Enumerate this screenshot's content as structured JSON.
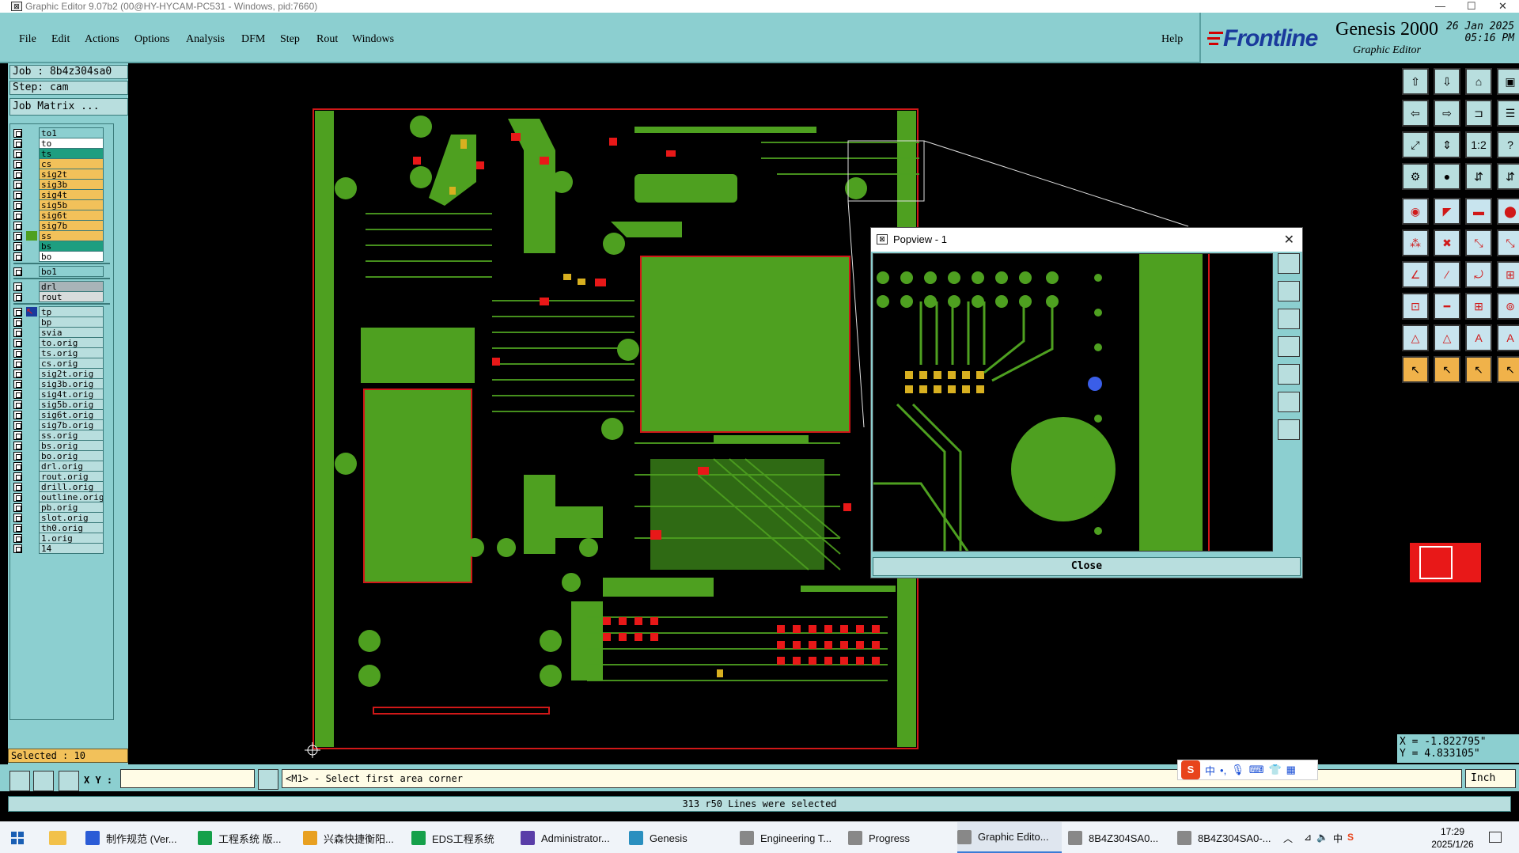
{
  "window": {
    "title": "Graphic Editor 9.07b2 (00@HY-HYCAM-PC531 - Windows, pid:7660)",
    "min": "—",
    "max": "☐",
    "close": "✕"
  },
  "menu": {
    "items": [
      "File",
      "Edit",
      "Actions",
      "Options",
      "Analysis",
      "DFM",
      "Step",
      "Rout",
      "Windows"
    ],
    "help": "Help"
  },
  "brand": {
    "logo": "Frontline",
    "product": "Genesis 2000",
    "subtitle": "Graphic Editor",
    "date": "26 Jan 2025",
    "time": "05:16 PM"
  },
  "left": {
    "job": "Job : 8b4z304sa0",
    "step": "Step: cam",
    "job_matrix": "Job Matrix ...",
    "layers_group1": [
      {
        "name": "to1",
        "color": "#8ccfd0"
      },
      {
        "name": "to",
        "color": "#ffffff"
      },
      {
        "name": "ts",
        "color": "#1e9e80"
      },
      {
        "name": "cs",
        "color": "#f2c15a"
      },
      {
        "name": "sig2t",
        "color": "#f2c15a"
      },
      {
        "name": "sig3b",
        "color": "#f2c15a"
      },
      {
        "name": "sig4t",
        "color": "#f2c15a"
      },
      {
        "name": "sig5b",
        "color": "#f2c15a"
      },
      {
        "name": "sig6t",
        "color": "#f2c15a"
      },
      {
        "name": "sig7b",
        "color": "#f2c15a"
      },
      {
        "name": "ss",
        "color": "#f2c15a"
      },
      {
        "name": "bs",
        "color": "#1e9e80"
      },
      {
        "name": "bo",
        "color": "#ffffff"
      }
    ],
    "layers_group2": [
      {
        "name": "bo1",
        "color": "#8ccfd0"
      }
    ],
    "layers_group3": [
      {
        "name": "drl",
        "color": "#a8b4b8"
      },
      {
        "name": "rout",
        "color": "#d8dcdc"
      }
    ],
    "layers_group4": [
      "tp",
      "bp",
      "svia",
      "to.orig",
      "ts.orig",
      "cs.orig",
      "sig2t.orig",
      "sig3b.orig",
      "sig4t.orig",
      "sig5b.orig",
      "sig6t.orig",
      "sig7b.orig",
      "ss.orig",
      "bs.orig",
      "bo.orig",
      "drl.orig",
      "rout.orig",
      "drill.orig",
      "outline.orig",
      "pb.orig",
      "slot.orig",
      "th0.orig",
      "1.orig",
      "14"
    ],
    "selected": "Selected : 10"
  },
  "popview": {
    "title": "Popview - 1",
    "close_label": "Close"
  },
  "coords": {
    "x": "X = -1.822795\"",
    "y": "Y = 4.833105\""
  },
  "command": {
    "xy_label": "X Y :",
    "xy_value": "",
    "message": "<M1> - Select first area corner",
    "units": "Inch",
    "ime_text": "中"
  },
  "status": "313 r50 Lines were selected",
  "taskbar": {
    "items": [
      {
        "label": "制作规范 (Ver...",
        "color": "#2b5cd6"
      },
      {
        "label": "工程系统 版...",
        "color": "#15a04a"
      },
      {
        "label": "兴森快捷衡阳...",
        "color": "#e8a020"
      },
      {
        "label": "EDS工程系统",
        "color": "#15a04a"
      },
      {
        "label": "Administrator...",
        "color": "#5a3ea8"
      },
      {
        "label": "Genesis",
        "color": "#2a8fbf"
      },
      {
        "label": "Engineering T...",
        "color": "#888888"
      },
      {
        "label": "Progress",
        "color": "#888888"
      },
      {
        "label": "Graphic Edito...",
        "color": "#888888"
      },
      {
        "label": "8B4Z304SA0...",
        "color": "#888888"
      },
      {
        "label": "8B4Z304SA0-...",
        "color": "#888888"
      }
    ],
    "time": "17:29",
    "date": "2025/1/26",
    "tray_lang": "中",
    "tray_ime": "S"
  }
}
